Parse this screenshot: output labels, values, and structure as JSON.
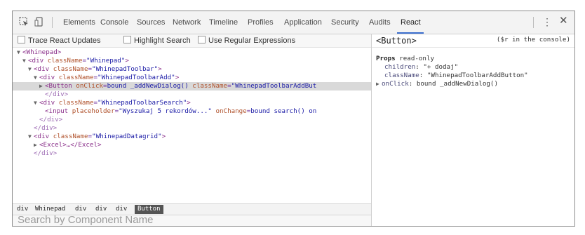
{
  "tabs": [
    "Elements",
    "Console",
    "Sources",
    "Network",
    "Timeline",
    "Profiles",
    "Application",
    "Security",
    "Audits",
    "React"
  ],
  "active_tab": "React",
  "options": [
    "Trace React Updates",
    "Highlight Search",
    "Use Regular Expressions"
  ],
  "tree": [
    {
      "open": "<Whinepad>"
    },
    {
      "tag": "div",
      "attr": "className",
      "val": "\"Whinepad\""
    },
    {
      "tag": "div",
      "attr": "className",
      "val": "\"WhinepadToolbar\""
    },
    {
      "tag": "div",
      "attr": "className",
      "val": "\"WhinepadToolbarAdd\""
    },
    {
      "selected_tag": "<Button",
      "attr1": "onClick",
      "val1": "bound _addNewDialog()",
      "attr2": "className",
      "val2": "\"WhinepadToolbarAddBut"
    },
    {
      "close": "</div>"
    },
    {
      "tag": "div",
      "attr": "className",
      "val": "\"WhinepadToolbarSearch\""
    },
    {
      "input_tag": "<input",
      "attr1": "placeholder",
      "val1": "\"Wyszukaj 5 rekordów...\"",
      "attr2": "onChange",
      "val2": "bound search() on"
    },
    {
      "close": "</div>"
    },
    {
      "close": "</div>"
    },
    {
      "tag": "div",
      "attr": "className",
      "val": "\"WhinepadDatagrid\""
    },
    {
      "excel": "<Excel>…</Excel>"
    },
    {
      "close": "</div>"
    }
  ],
  "breadcrumbs": [
    "div",
    "Whinepad",
    "div",
    "div",
    "div",
    "Button"
  ],
  "search_placeholder": "Search by Component Name",
  "panel": {
    "component": "<Button>",
    "console_hint": "($r in the console)",
    "props_label": "Props",
    "props_note": "read-only",
    "props": [
      {
        "name": "children",
        "value": "\"+ dodaj\""
      },
      {
        "name": "className",
        "value": "\"WhinepadToolbarAddButton\""
      },
      {
        "name": "onClick",
        "value": "bound _addNewDialog()"
      }
    ]
  }
}
